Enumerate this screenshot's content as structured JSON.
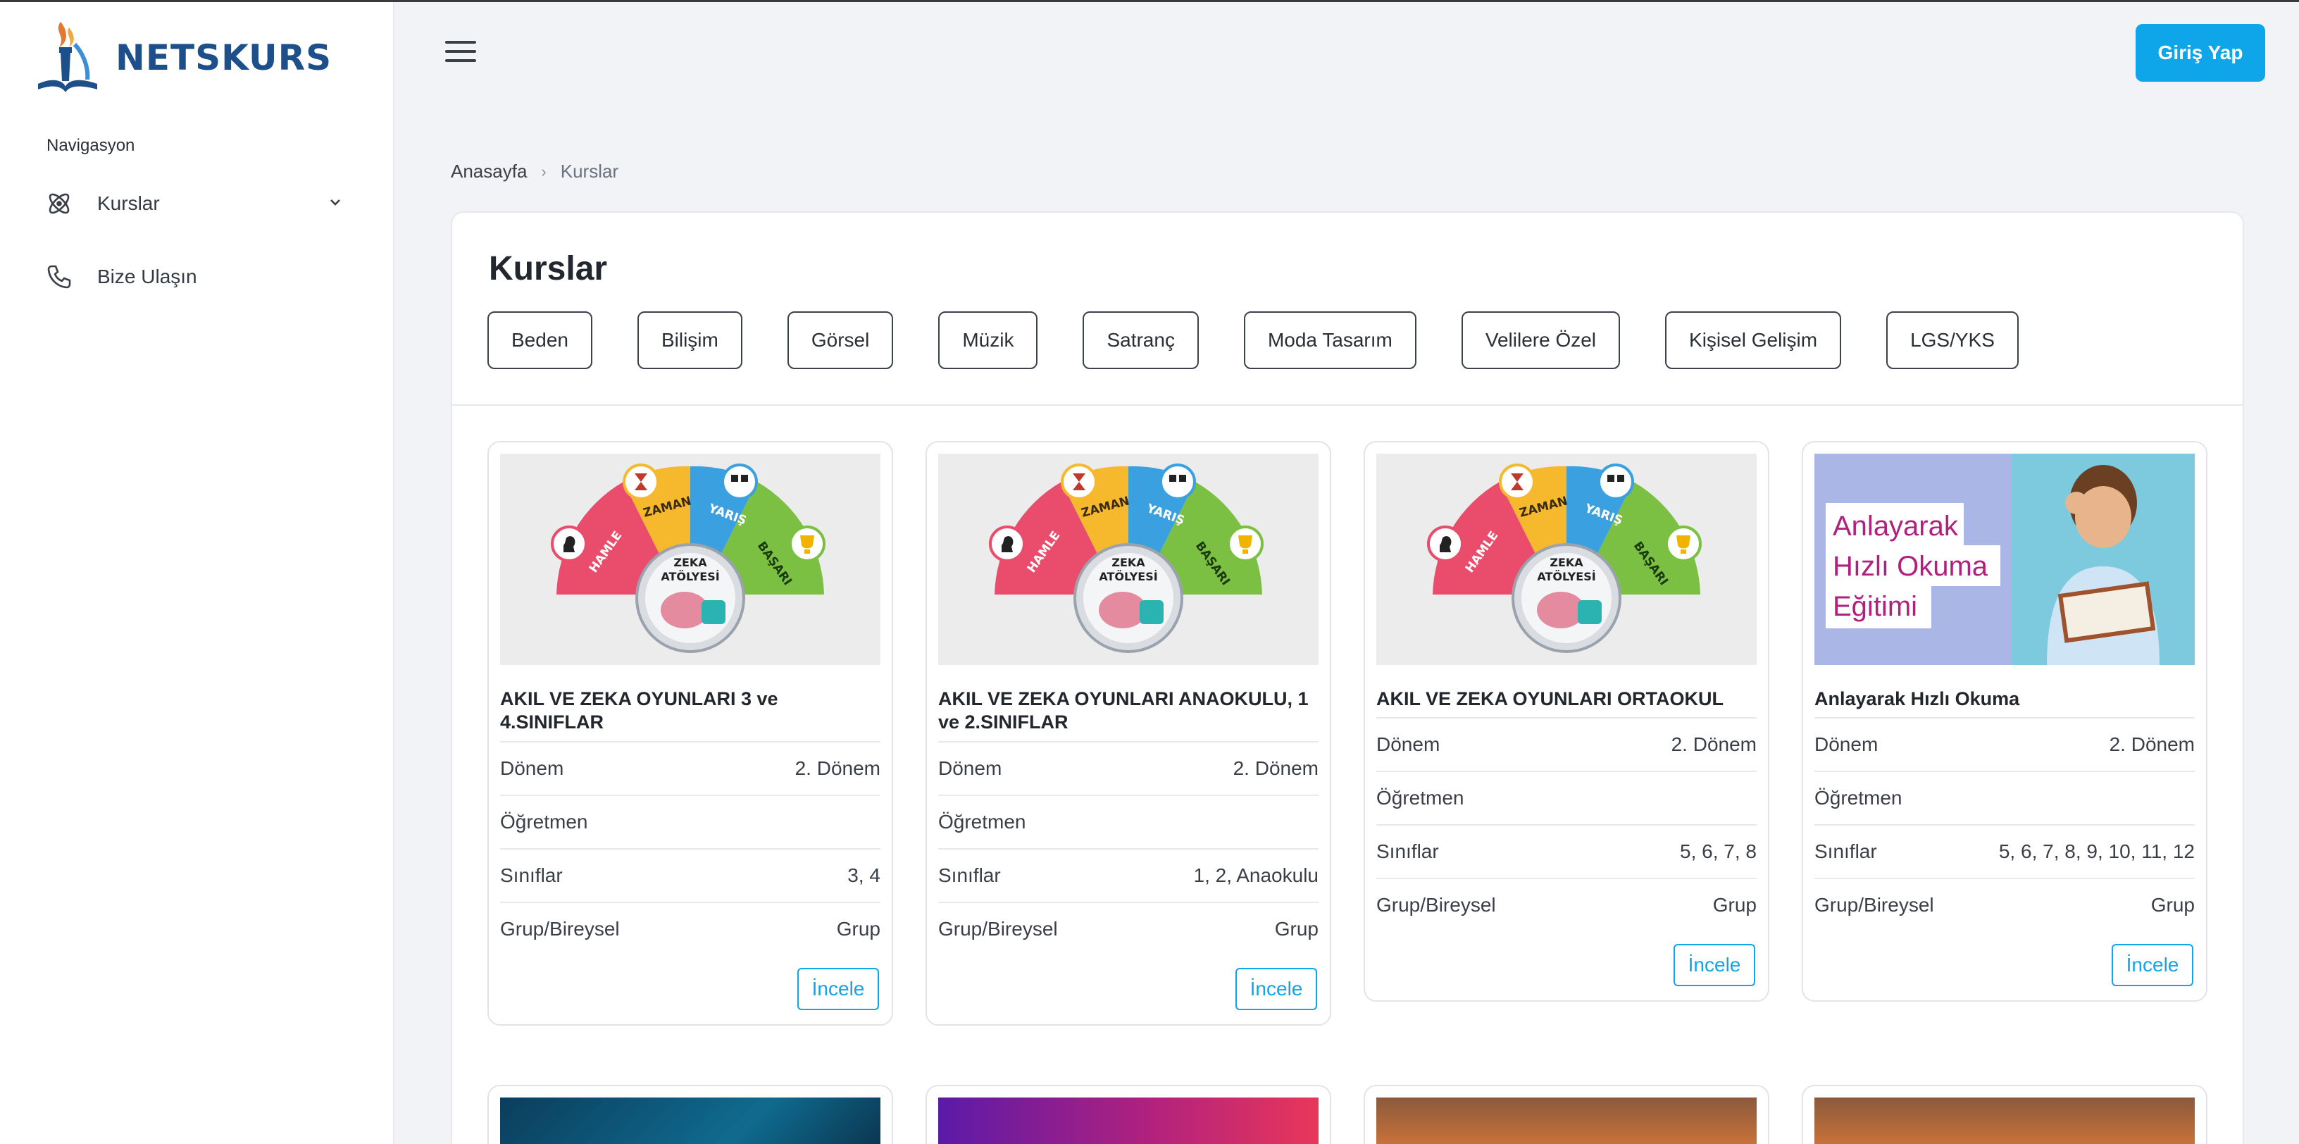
{
  "brand": {
    "name": "NETSKURS"
  },
  "sidebar": {
    "heading": "Navigasyon",
    "items": [
      {
        "label": "Kurslar",
        "icon": "atom-icon"
      },
      {
        "label": "Bize Ulaşın",
        "icon": "phone-icon"
      }
    ]
  },
  "header": {
    "login_label": "Giriş Yap"
  },
  "breadcrumb": {
    "home": "Anasayfa",
    "current": "Kurslar"
  },
  "page": {
    "title": "Kurslar",
    "filters": [
      "Beden",
      "Bilişim",
      "Görsel",
      "Müzik",
      "Satranç",
      "Moda Tasarım",
      "Velilere Özel",
      "Kişisel Gelişim",
      "LGS/YKS"
    ]
  },
  "labels": {
    "donem": "Dönem",
    "ogretmen": "Öğretmen",
    "siniflar": "Sınıflar",
    "grup": "Grup/Bireysel",
    "incele": "İncele"
  },
  "courses": [
    {
      "title": "AKIL VE ZEKA OYUNLARI 3 ve 4.SINIFLAR",
      "donem": "2. Dönem",
      "ogretmen": "",
      "siniflar": "3, 4",
      "grup": "Grup",
      "image": "zeka-atolyesi"
    },
    {
      "title": "AKIL VE ZEKA OYUNLARI ANAOKULU, 1 ve 2.SINIFLAR",
      "donem": "2. Dönem",
      "ogretmen": "",
      "siniflar": "1, 2, Anaokulu",
      "grup": "Grup",
      "image": "zeka-atolyesi"
    },
    {
      "title": "AKIL VE ZEKA OYUNLARI ORTAOKUL",
      "donem": "2. Dönem",
      "ogretmen": "",
      "siniflar": "5, 6, 7, 8",
      "grup": "Grup",
      "image": "zeka-atolyesi"
    },
    {
      "title": "Anlayarak Hızlı Okuma",
      "donem": "2. Dönem",
      "ogretmen": "",
      "siniflar": "5, 6, 7, 8, 9, 10, 11, 12",
      "grup": "Grup",
      "image": "hizli-okuma"
    }
  ],
  "zeka_image": {
    "segments": [
      "HAMLE",
      "ZAMAN",
      "YARIŞ",
      "BAŞARI"
    ],
    "center": [
      "ZEKA",
      "ATÖLYESİ"
    ]
  },
  "okuma_image": {
    "lines": [
      "Anlayarak",
      "Hızlı Okuma",
      "Eğitimi"
    ]
  },
  "colors": {
    "accent": "#0ea5e9",
    "brand": "#1d4f8a"
  }
}
